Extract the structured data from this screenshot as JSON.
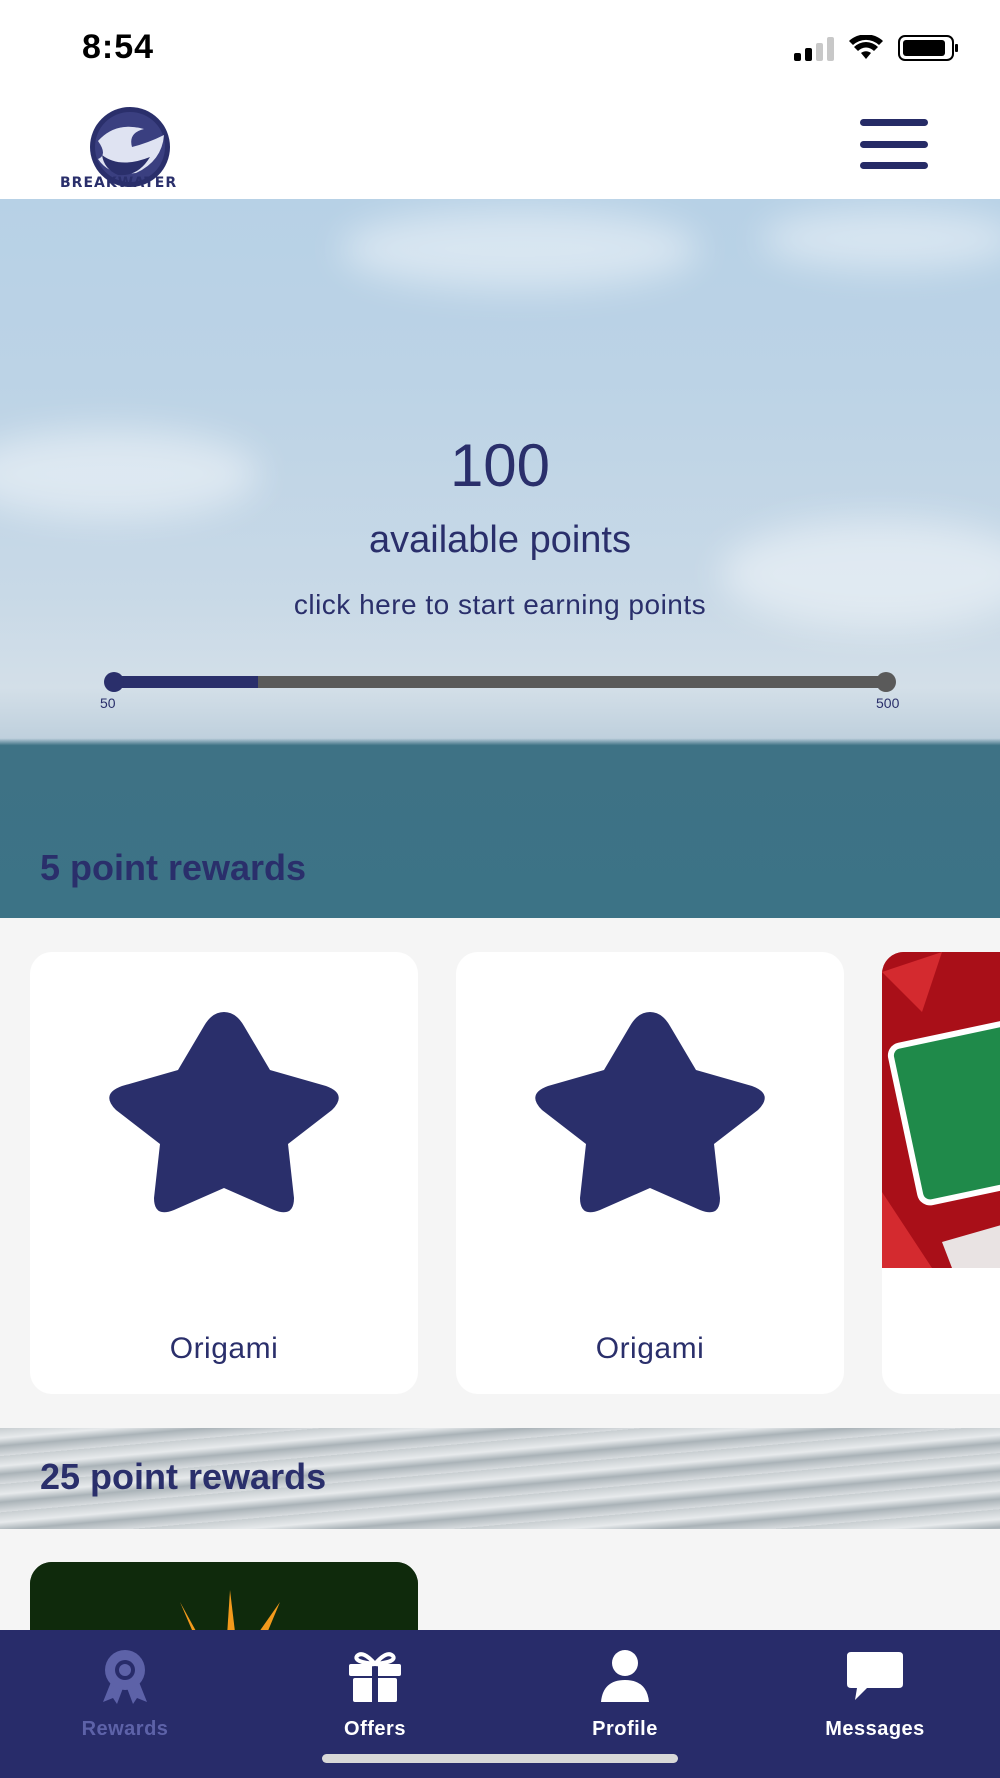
{
  "status_bar": {
    "time": "8:54"
  },
  "header": {
    "logo_text": "BREAKWATER"
  },
  "hero": {
    "points": "100",
    "points_label": "available points",
    "earn_link": "click here to start earning points",
    "progress": {
      "min": "50",
      "max": "500",
      "fill_fraction": 0.19
    }
  },
  "sections": [
    {
      "title": "5 point rewards",
      "cards": [
        {
          "label": "Origami",
          "icon": "star-icon"
        },
        {
          "label": "Origami",
          "icon": "star-icon"
        },
        {
          "label": "",
          "icon": "reward-image"
        }
      ]
    },
    {
      "title": "25 point rewards"
    }
  ],
  "tabs": [
    {
      "label": "Rewards",
      "icon": "ribbon-icon",
      "active": true
    },
    {
      "label": "Offers",
      "icon": "gift-icon",
      "active": false
    },
    {
      "label": "Profile",
      "icon": "person-icon",
      "active": false
    },
    {
      "label": "Messages",
      "icon": "chat-icon",
      "active": false
    }
  ],
  "colors": {
    "primary": "#2a2f6b",
    "tabbar": "#282c6a",
    "tab_inactive": "#5d62a8",
    "progress_track": "#5a5a5a"
  }
}
